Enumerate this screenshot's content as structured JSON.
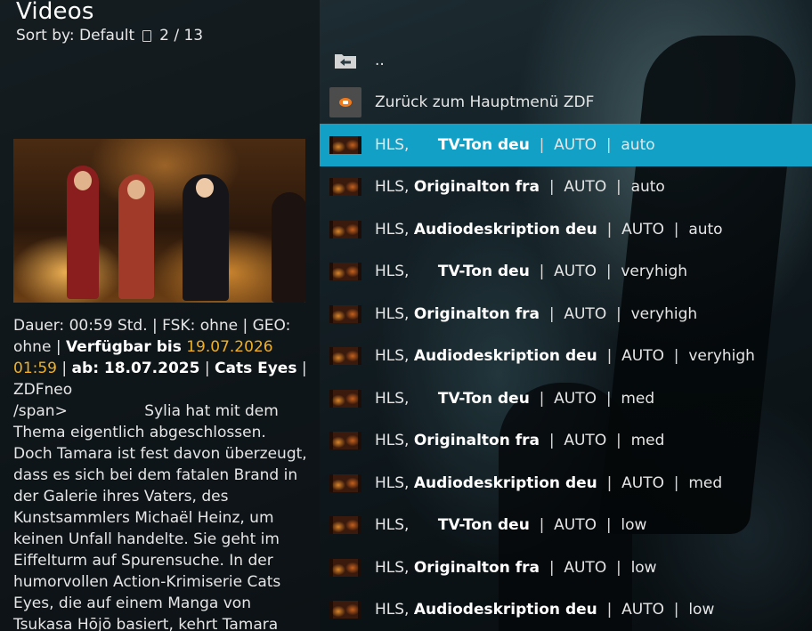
{
  "header": {
    "title": "Videos",
    "sort_label": "Sort by: Default",
    "sort_icon": "sort-order-icon",
    "position": "2 / 13"
  },
  "info": {
    "meta_line_a": "Dauer: 00:59 Std. | FSK: ohne | GEO: ohne | ",
    "available_label": "Verfügbar bis",
    "available_date": "19.07.2026 01:59",
    "pipe1": " | ",
    "from_label": "ab: 18.07.2025",
    "pipe2": " | ",
    "series": "Cats Eyes",
    "pipe3": " | ",
    "channel": "ZDFneo",
    "plot_prefix": "/span>",
    "plot_spacing": "                ",
    "plot": "Sylia hat mit dem Thema eigentlich abgeschlossen. Doch Tamara ist fest davon überzeugt, dass es sich bei dem fatalen Brand in der Galerie ihres Vaters, des Kunstsammlers Michaël Heinz, um keinen Unfall handelte. Sie geht im Eiffelturm auf Spurensuche. In der humorvollen Action-Krimiserie Cats Eyes, die auf einem Manga von Tsukasa Hōjō basiert, kehrt Tamara"
  },
  "list": {
    "parent": {
      "label": "..",
      "icon": "folder-back-icon"
    },
    "back": {
      "label": "Zurück zum Hauptmenü ZDF",
      "icon": "zdf-logo-icon"
    },
    "sep": "|",
    "items": [
      {
        "proto": "HLS,",
        "pad": "      ",
        "audio": "TV-Ton deu",
        "res": "AUTO",
        "quality": "auto",
        "selected": true
      },
      {
        "proto": "HLS,",
        "pad": " ",
        "audio": "Originalton fra",
        "res": "AUTO",
        "quality": "auto",
        "selected": false
      },
      {
        "proto": "HLS,",
        "pad": " ",
        "audio": "Audiodeskription deu",
        "res": "AUTO",
        "quality": "auto",
        "selected": false
      },
      {
        "proto": "HLS,",
        "pad": "      ",
        "audio": "TV-Ton deu",
        "res": "AUTO",
        "quality": "veryhigh",
        "selected": false
      },
      {
        "proto": "HLS,",
        "pad": " ",
        "audio": "Originalton fra",
        "res": "AUTO",
        "quality": "veryhigh",
        "selected": false
      },
      {
        "proto": "HLS,",
        "pad": " ",
        "audio": "Audiodeskription deu",
        "res": "AUTO",
        "quality": "veryhigh",
        "selected": false
      },
      {
        "proto": "HLS,",
        "pad": "      ",
        "audio": "TV-Ton deu",
        "res": "AUTO",
        "quality": "med",
        "selected": false
      },
      {
        "proto": "HLS,",
        "pad": " ",
        "audio": "Originalton fra",
        "res": "AUTO",
        "quality": "med",
        "selected": false
      },
      {
        "proto": "HLS,",
        "pad": " ",
        "audio": "Audiodeskription deu",
        "res": "AUTO",
        "quality": "med",
        "selected": false
      },
      {
        "proto": "HLS,",
        "pad": "      ",
        "audio": "TV-Ton deu",
        "res": "AUTO",
        "quality": "low",
        "selected": false
      },
      {
        "proto": "HLS,",
        "pad": " ",
        "audio": "Originalton fra",
        "res": "AUTO",
        "quality": "low",
        "selected": false
      },
      {
        "proto": "HLS,",
        "pad": " ",
        "audio": "Audiodeskription deu",
        "res": "AUTO",
        "quality": "low",
        "selected": false
      }
    ]
  },
  "colors": {
    "selection": "#12a0c7",
    "highlight_date": "#f0b022"
  }
}
